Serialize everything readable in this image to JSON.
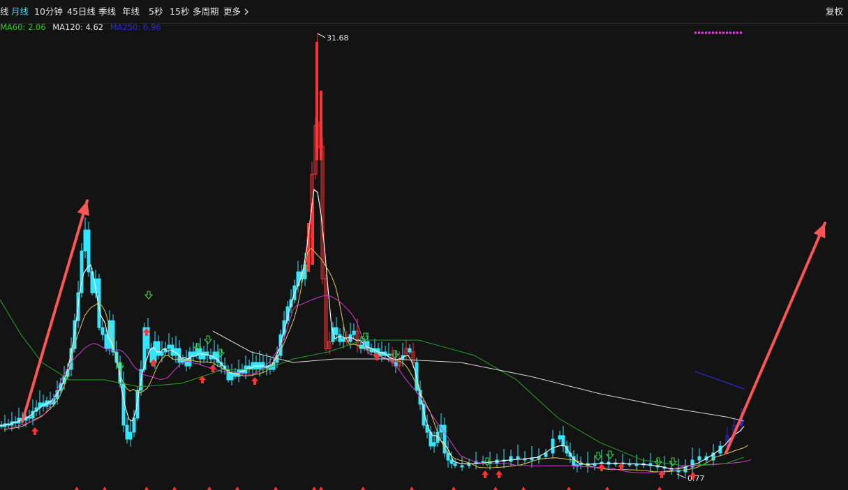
{
  "toolbar": {
    "partial_tab": "线",
    "tabs": [
      "月线",
      "10分钟",
      "45日线",
      "季线",
      "年线",
      "5秒",
      "15秒",
      "多周期",
      "更多"
    ],
    "active_tab": "月线",
    "more_icon": "chevron-right-icon",
    "restore_label": "复权"
  },
  "legend": {
    "ma60": "MA60: 2.06",
    "ma120": "MA120: 4.62",
    "ma250": "MA250: 6.96"
  },
  "colors": {
    "up": "#ff3333",
    "down": "#33e6ff",
    "ma_white": "#f2f2f2",
    "ma_yellow": "#e6c84a",
    "ma_magenta": "#d23cd2",
    "ma_green": "#27a327",
    "ma_gray": "#d9d9d9",
    "ma250_blue": "#2a2ad4",
    "arrow": "#ff5555",
    "dotted_marker": "#ff33ff"
  },
  "chart_data": {
    "type": "candlestick",
    "title": "",
    "y_price_scale": [
      0.5,
      32
    ],
    "annotations": {
      "high": "31.68",
      "low": "0.77"
    },
    "price_high": 31.68,
    "price_low": 0.77,
    "candles_count": 160,
    "markers": {
      "buy_up_arrows": [
        6,
        28,
        29,
        38,
        41,
        47,
        88,
        99,
        134,
        141,
        152,
        157,
        173,
        175
      ],
      "sell_down_arrows": [
        23,
        37,
        40,
        44,
        99,
        130,
        134,
        154,
        157,
        172,
        173
      ]
    },
    "trend_arrows": [
      "left rising arrow",
      "right rising arrow"
    ]
  }
}
